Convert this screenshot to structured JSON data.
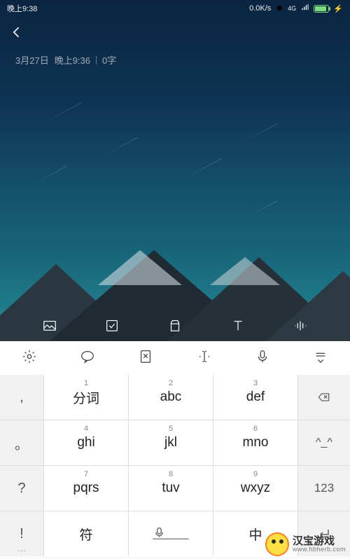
{
  "status": {
    "time": "晚上9:38",
    "net_speed": "0.0K/s",
    "signal_label": "4G"
  },
  "note": {
    "date": "3月27日",
    "time": "晚上9:36",
    "word_count": "0字"
  },
  "toolbar_icons": {
    "image": "image-icon",
    "checklist": "checklist-icon",
    "clipboard": "clipboard-icon",
    "text": "text-style-icon",
    "voice": "voice-wave-icon"
  },
  "kb_top_icons": {
    "settings": "gear-icon",
    "input": "speech-icon",
    "clipboard": "clipboard-cut-icon",
    "cursor": "cursor-icon",
    "mic": "microphone-icon",
    "collapse": "collapse-icon"
  },
  "kb": {
    "side_left": [
      ",",
      "。",
      "?",
      "!",
      "…"
    ],
    "keys": [
      {
        "num": "1",
        "label": "分词"
      },
      {
        "num": "2",
        "label": "abc"
      },
      {
        "num": "3",
        "label": "def"
      },
      {
        "num": "4",
        "label": "ghi"
      },
      {
        "num": "5",
        "label": "jkl"
      },
      {
        "num": "6",
        "label": "mno"
      },
      {
        "num": "7",
        "label": "pqrs"
      },
      {
        "num": "8",
        "label": "tuv"
      },
      {
        "num": "9",
        "label": "wxyz"
      }
    ],
    "side_right": {
      "backspace": "⌫",
      "emoji": "^_^",
      "numeric": "123"
    },
    "bottom": {
      "symbol": "符",
      "lang": "中"
    }
  },
  "watermark": {
    "title": "汉宝游戏",
    "url": "www.hbherb.com"
  }
}
